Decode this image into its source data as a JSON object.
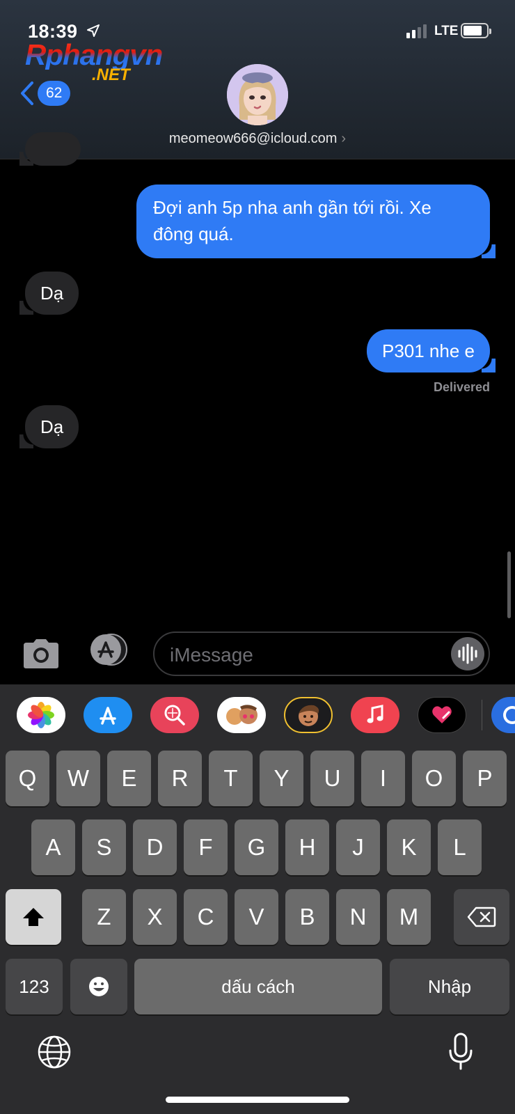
{
  "status_bar": {
    "time": "18:39",
    "network": "LTE",
    "battery_level_pct": 80,
    "signal_bars_full": 2,
    "signal_bars_total": 4
  },
  "watermark": {
    "main": "Rphangvn",
    "sub": ".NET"
  },
  "header": {
    "back_badge_count": "62",
    "contact": "meomeow666@icloud.com",
    "contact_chevron": "›"
  },
  "messages": [
    {
      "from": "me",
      "text_lines": [
        "Đợi anh 5p nha anh gần tới rồi. Xe",
        "đông quá."
      ]
    },
    {
      "from": "them",
      "text": "Dạ"
    },
    {
      "from": "me",
      "text": "P301 nhe e"
    },
    {
      "from": "them",
      "text": "Dạ"
    }
  ],
  "delivered_label": "Delivered",
  "input": {
    "placeholder": "iMessage"
  },
  "app_strip": [
    "photos-icon",
    "app-store-icon",
    "search-images-icon",
    "memoji-stickers-icon",
    "memoji-icon",
    "music-icon",
    "digital-touch-icon",
    "more-apps-icon"
  ],
  "keyboard": {
    "row1": [
      "Q",
      "W",
      "E",
      "R",
      "T",
      "Y",
      "U",
      "I",
      "O",
      "P"
    ],
    "row2": [
      "A",
      "S",
      "D",
      "F",
      "G",
      "H",
      "J",
      "K",
      "L"
    ],
    "row3": [
      "Z",
      "X",
      "C",
      "V",
      "B",
      "N",
      "M"
    ],
    "numbers_label": "123",
    "space_label": "dấu cách",
    "return_label": "Nhập"
  },
  "colors": {
    "sent_bubble": "#2f7bf5",
    "received_bubble": "#262628",
    "keyboard_bg": "#2c2c2e",
    "key": "#6b6b6b"
  }
}
